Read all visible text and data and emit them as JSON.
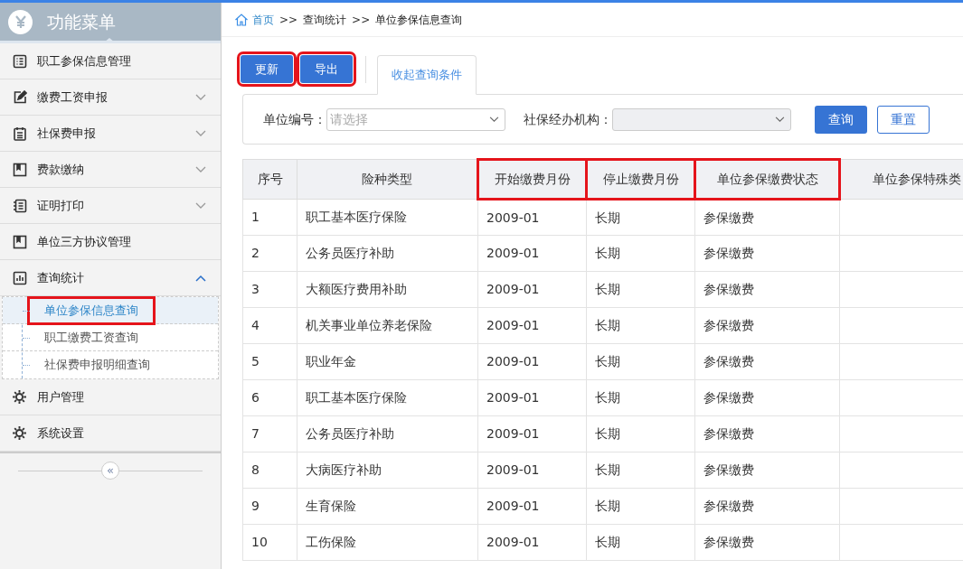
{
  "sidebar": {
    "title": "功能菜单",
    "items": [
      {
        "label": "职工参保信息管理",
        "kind": "grid"
      },
      {
        "label": "缴费工资申报",
        "kind": "edit",
        "expanded": false
      },
      {
        "label": "社保费申报",
        "kind": "clipboard",
        "expanded": false
      },
      {
        "label": "费款缴纳",
        "kind": "book",
        "expanded": false
      },
      {
        "label": "证明打印",
        "kind": "list",
        "expanded": false
      },
      {
        "label": "单位三方协议管理",
        "kind": "book"
      },
      {
        "label": "查询统计",
        "kind": "chart",
        "expanded": true,
        "children": [
          {
            "label": "单位参保信息查询",
            "selected": true,
            "highlighted": true
          },
          {
            "label": "职工缴费工资查询",
            "selected": false,
            "highlighted": false
          },
          {
            "label": "社保费申报明细查询",
            "selected": false,
            "highlighted": false
          }
        ]
      },
      {
        "label": "用户管理",
        "kind": "gear"
      },
      {
        "label": "系统设置",
        "kind": "gear"
      }
    ],
    "collapse_button": "«"
  },
  "breadcrumb": [
    {
      "label": "首页",
      "link": true
    },
    {
      "label": "查询统计",
      "link": false
    },
    {
      "label": "单位参保信息查询",
      "link": false
    }
  ],
  "breadcrumb_separator": ">>",
  "toolbar": {
    "buttons": [
      {
        "label": "更新",
        "highlighted": true
      },
      {
        "label": "导出",
        "highlighted": true
      }
    ],
    "tab": "收起查询条件"
  },
  "filters": [
    {
      "label": "单位编号：",
      "placeholder": "请选择",
      "disabled": false
    },
    {
      "label": "社保经办机构：",
      "disabled": true
    }
  ],
  "filter_buttons": [
    {
      "label": "查询",
      "primary": true
    },
    {
      "label": "重置",
      "primary": false
    }
  ],
  "table": {
    "columns": [
      {
        "label": "序号",
        "highlighted": false
      },
      {
        "label": "险种类型",
        "highlighted": false
      },
      {
        "label": "开始缴费月份",
        "highlighted": true
      },
      {
        "label": "停止缴费月份",
        "highlighted": true
      },
      {
        "label": "单位参保缴费状态",
        "highlighted": true
      },
      {
        "label": "单位参保特殊类",
        "highlighted": false
      }
    ],
    "rows": [
      [
        "1",
        "职工基本医疗保险",
        "2009-01",
        "长期",
        "参保缴费",
        ""
      ],
      [
        "2",
        "公务员医疗补助",
        "2009-01",
        "长期",
        "参保缴费",
        ""
      ],
      [
        "3",
        "大额医疗费用补助",
        "2009-01",
        "长期",
        "参保缴费",
        ""
      ],
      [
        "4",
        "机关事业单位养老保险",
        "2009-01",
        "长期",
        "参保缴费",
        ""
      ],
      [
        "5",
        "职业年金",
        "2009-01",
        "长期",
        "参保缴费",
        ""
      ],
      [
        "6",
        "职工基本医疗保险",
        "2009-01",
        "长期",
        "参保缴费",
        ""
      ],
      [
        "7",
        "公务员医疗补助",
        "2009-01",
        "长期",
        "参保缴费",
        ""
      ],
      [
        "8",
        "大病医疗补助",
        "2009-01",
        "长期",
        "参保缴费",
        ""
      ],
      [
        "9",
        "生育保险",
        "2009-01",
        "长期",
        "参保缴费",
        ""
      ],
      [
        "10",
        "工伤保险",
        "2009-01",
        "长期",
        "参保缴费",
        ""
      ]
    ]
  }
}
